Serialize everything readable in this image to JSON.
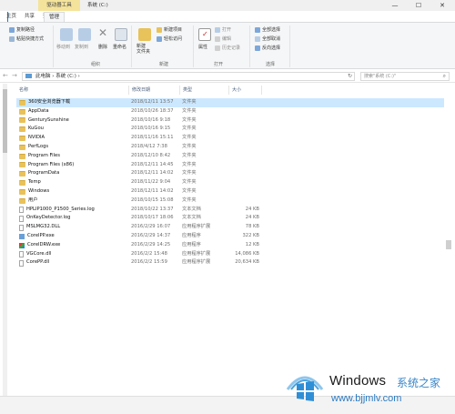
{
  "titlebar": {
    "context_tab": "驱动器工具",
    "title": "系统 (C:)",
    "minimize": "—",
    "maximize": "☐",
    "close": "✕"
  },
  "tabs": [
    "主页",
    "共享",
    "查看",
    "管理"
  ],
  "ribbon": {
    "clipboard": {
      "copy_path": "复制路径",
      "paste_shortcut": "粘贴快捷方式",
      "label": ""
    },
    "organize": {
      "move_to": "移动到",
      "copy_to": "复制到",
      "delete": "删除",
      "rename": "重命名",
      "label": "组织"
    },
    "new": {
      "new_folder": "新建\n文件夹",
      "new_item": "新建项目",
      "easy_access": "轻松访问",
      "label": "新建"
    },
    "open": {
      "properties": "属性",
      "open": "打开",
      "edit": "编辑",
      "history": "历史记录",
      "label": "打开"
    },
    "select": {
      "select_all": "全部选择",
      "select_none": "全部取消",
      "invert": "反向选择",
      "label": "选择"
    }
  },
  "address": {
    "breadcrumb": "此电脑  ›  系统 (C:)  ›",
    "search_placeholder": "搜索\"系统 (C:)\""
  },
  "columns": [
    "名称",
    "修改日期",
    "类型",
    "大小"
  ],
  "files": [
    {
      "name": "360安全浏览器下载",
      "date": "2018/12/11 13:57",
      "type": "文件夹",
      "size": "",
      "icon": "folder",
      "selected": true
    },
    {
      "name": "AppData",
      "date": "2018/10/26 18:37",
      "type": "文件夹",
      "size": "",
      "icon": "folder"
    },
    {
      "name": "GenturySunshine",
      "date": "2018/10/16 9:18",
      "type": "文件夹",
      "size": "",
      "icon": "folder"
    },
    {
      "name": "KuGou",
      "date": "2018/10/16 9:15",
      "type": "文件夹",
      "size": "",
      "icon": "folder"
    },
    {
      "name": "NVIDIA",
      "date": "2018/11/16 15:11",
      "type": "文件夹",
      "size": "",
      "icon": "folder"
    },
    {
      "name": "PerfLogs",
      "date": "2018/4/12 7:38",
      "type": "文件夹",
      "size": "",
      "icon": "folder"
    },
    {
      "name": "Program Files",
      "date": "2018/12/10 8:42",
      "type": "文件夹",
      "size": "",
      "icon": "folder"
    },
    {
      "name": "Program Files (x86)",
      "date": "2018/12/11 14:45",
      "type": "文件夹",
      "size": "",
      "icon": "folder"
    },
    {
      "name": "ProgramData",
      "date": "2018/12/11 14:02",
      "type": "文件夹",
      "size": "",
      "icon": "folder"
    },
    {
      "name": "Temp",
      "date": "2018/11/22 9:04",
      "type": "文件夹",
      "size": "",
      "icon": "folder"
    },
    {
      "name": "Windows",
      "date": "2018/12/11 14:02",
      "type": "文件夹",
      "size": "",
      "icon": "folder"
    },
    {
      "name": "用户",
      "date": "2018/10/15 15:08",
      "type": "文件夹",
      "size": "",
      "icon": "folder"
    },
    {
      "name": "HPLIP1000_P1500_Series.log",
      "date": "2018/10/22 13:37",
      "type": "文本文档",
      "size": "24 KB",
      "icon": "file"
    },
    {
      "name": "OnKeyDetector.log",
      "date": "2018/10/17 18:06",
      "type": "文本文档",
      "size": "24 KB",
      "icon": "file"
    },
    {
      "name": "MSLMG32.DLL",
      "date": "2016/2/29 16:07",
      "type": "应用程序扩展",
      "size": "78 KB",
      "icon": "file"
    },
    {
      "name": "CorelPP.exe",
      "date": "2016/2/29 14:37",
      "type": "应用程序",
      "size": "322 KB",
      "icon": "exe"
    },
    {
      "name": "CorelDRW.exe",
      "date": "2016/2/29 14:25",
      "type": "应用程序",
      "size": "12 KB",
      "icon": "exe2"
    },
    {
      "name": "VGCore.dll",
      "date": "2016/2/2 15:48",
      "type": "应用程序扩展",
      "size": "14,086 KB",
      "icon": "file"
    },
    {
      "name": "CorePP.dll",
      "date": "2016/2/2 15:59",
      "type": "应用程序扩展",
      "size": "20,634 KB",
      "icon": "file"
    }
  ],
  "watermark": {
    "brand": "Windows",
    "brand_cn": "系统之家",
    "url": "www.bjjmlv.com"
  },
  "colors": {
    "selection": "#cce8ff",
    "folder": "#e8c25a",
    "context_tab": "#f4e39a"
  }
}
